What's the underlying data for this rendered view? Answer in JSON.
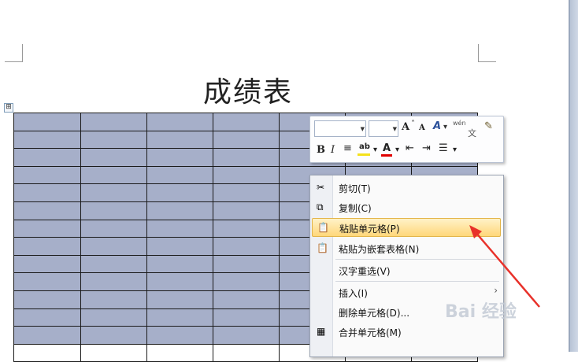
{
  "document": {
    "title": "成绩表",
    "table_handle_symbol": "⊞",
    "table": {
      "rows": 14,
      "cols": 7
    }
  },
  "mini_toolbar": {
    "font_name": "",
    "font_size": "",
    "grow_font": "A",
    "shrink_font": "A",
    "styles": "A",
    "phonetic": "wén",
    "bold": "B",
    "italic": "I",
    "center": "≡",
    "highlight": "ab",
    "font_color": "A",
    "colors": {
      "highlight": "#f5e11b",
      "font_color": "#e00000"
    }
  },
  "context_menu": {
    "items": [
      {
        "label": "剪切(T)",
        "icon": "scissors-icon"
      },
      {
        "label": "复制(C)",
        "icon": "copy-icon"
      },
      {
        "label": "粘贴单元格(P)",
        "icon": "paste-icon",
        "highlighted": true
      },
      {
        "label": "粘贴为嵌套表格(N)",
        "icon": "paste-nested-icon"
      },
      {
        "label": "汉字重选(V)",
        "icon": ""
      },
      {
        "label": "插入(I)",
        "icon": "",
        "submenu": true
      },
      {
        "label": "删除单元格(D)...",
        "icon": ""
      },
      {
        "label": "合并单元格(M)",
        "icon": "merge-cells-icon"
      }
    ]
  },
  "watermark": {
    "text": "Bai 经验"
  },
  "colors": {
    "selection": "#a6afc9",
    "menu_highlight": "#ffd77a",
    "arrow": "#e8312a"
  }
}
